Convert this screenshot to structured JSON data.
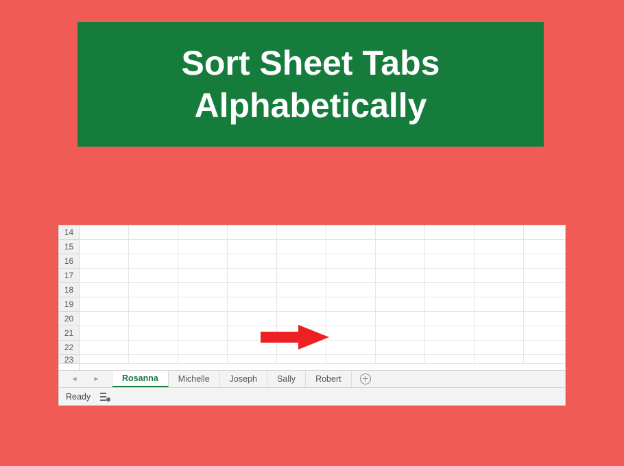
{
  "title": "Sort Sheet Tabs Alphabetically",
  "rows": [
    "14",
    "15",
    "16",
    "17",
    "18",
    "19",
    "20",
    "21",
    "22",
    "23"
  ],
  "tabs": [
    {
      "label": "Rosanna",
      "active": true
    },
    {
      "label": "Michelle",
      "active": false
    },
    {
      "label": "Joseph",
      "active": false
    },
    {
      "label": "Sally",
      "active": false
    },
    {
      "label": "Robert",
      "active": false
    }
  ],
  "nav": {
    "prev": "◄",
    "next": "►"
  },
  "status": {
    "text": "Ready"
  },
  "colors": {
    "background": "#f15b56",
    "title_bg": "#167c3c",
    "active_tab_accent": "#167c3c",
    "arrow": "#ed2024"
  }
}
